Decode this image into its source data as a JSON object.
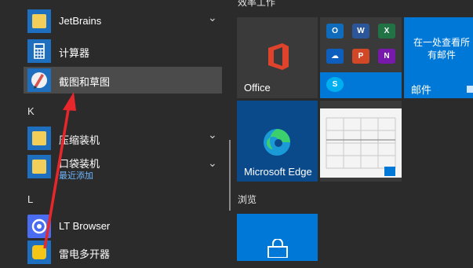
{
  "groups": {
    "create_partial": "效率工作",
    "browse": "浏览"
  },
  "apps": [
    {
      "label": "JetBrains",
      "sub": "",
      "expandable": true
    },
    {
      "label": "计算器",
      "sub": "",
      "expandable": false
    },
    {
      "label": "截图和草图",
      "sub": "",
      "expandable": false
    },
    {
      "label": "压缩装机",
      "sub": "",
      "expandable": true
    },
    {
      "label": "口袋装机",
      "sub": "最近添加",
      "expandable": true
    },
    {
      "label": "LT Browser",
      "sub": "",
      "expandable": false
    },
    {
      "label": "雷电多开器",
      "sub": "",
      "expandable": false
    }
  ],
  "letters": {
    "k": "K",
    "l": "L"
  },
  "tiles": {
    "office": "Office",
    "mail_text": "在一处查看所有邮件",
    "mail_label": "邮件",
    "edge": "Microsoft Edge"
  },
  "icons": {
    "app_icons": [
      "folder-icon",
      "calculator-icon",
      "snip-sketch-icon",
      "folder-icon",
      "folder-icon",
      "lt-browser-icon",
      "emulator-icon"
    ],
    "office_minis": [
      "outlook-icon",
      "word-icon",
      "excel-icon",
      "onedrive-icon",
      "powerpoint-icon",
      "onenote-icon",
      "skype-icon"
    ]
  },
  "colors": {
    "accent_blue": "#0078d7",
    "annotation_arrow": "#e8272c"
  }
}
